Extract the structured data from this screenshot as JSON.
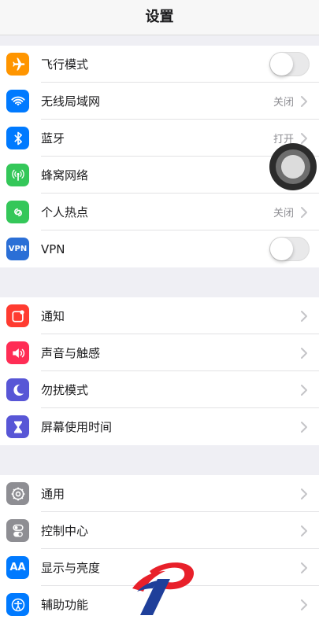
{
  "title": "设置",
  "groups": [
    {
      "rows": [
        {
          "label": "飞行模式",
          "icon": "airplane-icon",
          "color": "#ff9500",
          "control": "toggle",
          "on": false
        },
        {
          "label": "无线局域网",
          "icon": "wifi-icon",
          "color": "#007aff",
          "value": "关闭"
        },
        {
          "label": "蓝牙",
          "icon": "bluetooth-icon",
          "color": "#007aff",
          "value": "打开"
        },
        {
          "label": "蜂窝网络",
          "icon": "antenna-icon",
          "color": "#34c759"
        },
        {
          "label": "个人热点",
          "icon": "hotspot-icon",
          "color": "#34c759",
          "value": "关闭"
        },
        {
          "label": "VPN",
          "icon": "vpn-icon",
          "color": "#2b6fd6",
          "icon_text": "VPN",
          "control": "toggle",
          "on": false
        }
      ]
    },
    {
      "rows": [
        {
          "label": "通知",
          "icon": "notifications-icon",
          "color": "#ff3b30"
        },
        {
          "label": "声音与触感",
          "icon": "speaker-icon",
          "color": "#ff2d55"
        },
        {
          "label": "勿扰模式",
          "icon": "moon-icon",
          "color": "#5856d6"
        },
        {
          "label": "屏幕使用时间",
          "icon": "hourglass-icon",
          "color": "#5856d6"
        }
      ]
    },
    {
      "rows": [
        {
          "label": "通用",
          "icon": "gear-icon",
          "color": "#8e8e93"
        },
        {
          "label": "控制中心",
          "icon": "switches-icon",
          "color": "#8e8e93"
        },
        {
          "label": "显示与亮度",
          "icon": "text-size-icon",
          "color": "#007aff",
          "icon_text": "AA"
        },
        {
          "label": "辅助功能",
          "icon": "accessibility-icon",
          "color": "#007aff"
        }
      ]
    }
  ],
  "overlays": {
    "assistive_touch": "assistive-touch-button",
    "watermark": "watermark-logo-icon"
  }
}
